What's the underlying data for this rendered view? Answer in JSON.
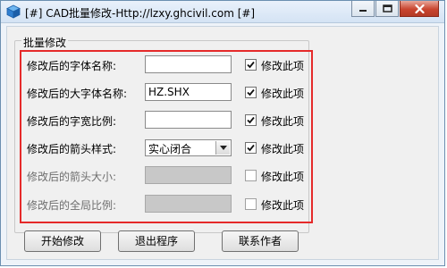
{
  "window": {
    "title": "[#] CAD批量修改-Http://lzxy.ghcivil.com [#]"
  },
  "group": {
    "label": "批量修改"
  },
  "rows": [
    {
      "label": "修改后的字体名称:",
      "value": "",
      "control": "text",
      "enabled": true,
      "check_label": "修改此项",
      "checked": true
    },
    {
      "label": "修改后的大字体名称:",
      "value": "HZ.SHX",
      "control": "text",
      "enabled": true,
      "check_label": "修改此项",
      "checked": true
    },
    {
      "label": "修改后的字宽比例:",
      "value": "",
      "control": "text",
      "enabled": true,
      "check_label": "修改此项",
      "checked": true
    },
    {
      "label": "修改后的箭头样式:",
      "value": "实心闭合",
      "control": "select",
      "enabled": true,
      "check_label": "修改此项",
      "checked": true
    },
    {
      "label": "修改后的箭头大小:",
      "value": "",
      "control": "text",
      "enabled": false,
      "check_label": "修改此项",
      "checked": false
    },
    {
      "label": "修改后的全局比例:",
      "value": "",
      "control": "text",
      "enabled": false,
      "check_label": "修改此项",
      "checked": false
    }
  ],
  "buttons": {
    "start": "开始修改",
    "exit": "退出程序",
    "contact": "联系作者"
  },
  "colors": {
    "highlight_frame": "#e52a2a",
    "disabled_field": "#c8c8c8"
  },
  "icons": {
    "app": "app-cube-icon",
    "minimize": "minimize-icon",
    "maximize": "maximize-icon",
    "close": "close-icon",
    "checkmark": "checkmark-icon",
    "dropdown": "chevron-down-icon"
  }
}
